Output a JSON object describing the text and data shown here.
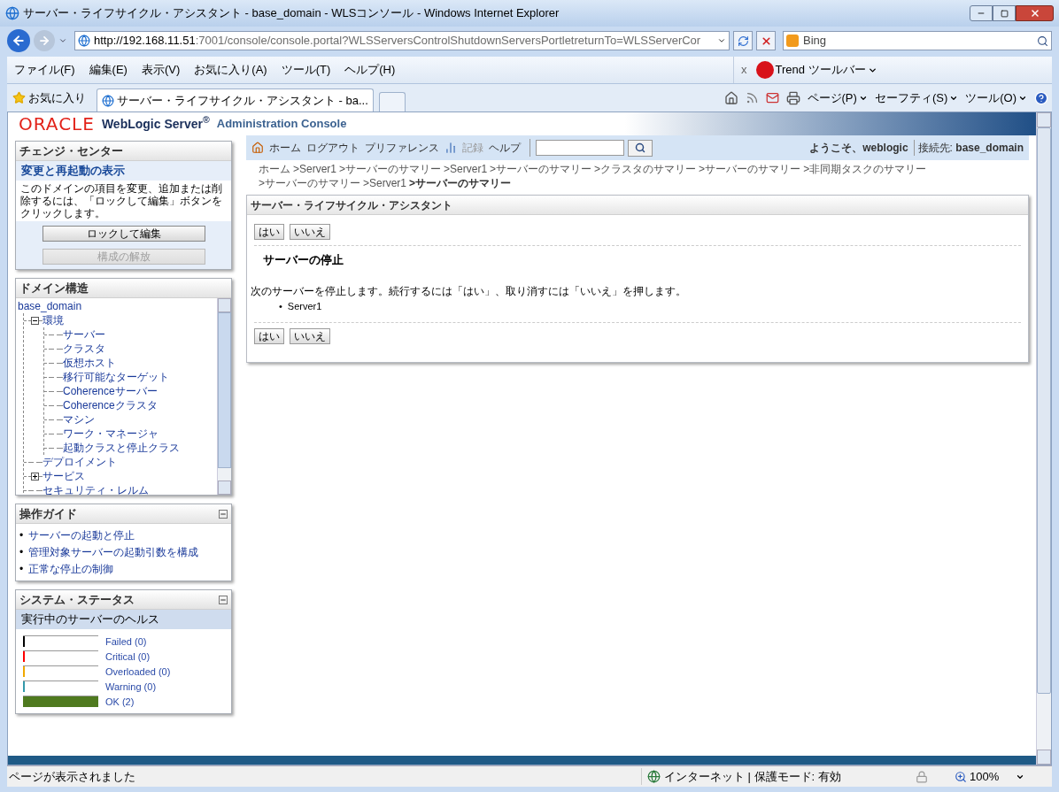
{
  "window": {
    "title": "サーバー・ライフサイクル・アシスタント - base_domain - WLSコンソール - Windows Internet Explorer"
  },
  "address_bar": {
    "url_host": "http://192.168.11.51",
    "url_rest": ":7001/console/console.portal?WLSServersControlShutdownServersPortletreturnTo=WLSServerCor"
  },
  "search_box": {
    "provider": "Bing"
  },
  "menu": [
    "ファイル(F)",
    "編集(E)",
    "表示(V)",
    "お気に入り(A)",
    "ツール(T)",
    "ヘルプ(H)"
  ],
  "toolbar_close": "x",
  "trend_toolbar": "Trend ツールバー",
  "favorites_bar": {
    "favorites": "お気に入り",
    "tab": "サーバー・ライフサイクル・アシスタント - ba...",
    "commands": [
      "ページ(P)",
      "セーフティ(S)",
      "ツール(O)"
    ]
  },
  "header": {
    "brand": "ORACLE",
    "product": "WebLogic Server",
    "mark": "®",
    "subtitle": "Administration Console"
  },
  "change_center": {
    "title": "チェンジ・センター",
    "link": "変更と再起動の表示",
    "text": "このドメインの項目を変更、追加または削除するには、「ロックして編集」ボタンをクリックします。",
    "buttons": [
      {
        "label": "ロックして編集",
        "disabled": false
      },
      {
        "label": "構成の解放",
        "disabled": true
      }
    ]
  },
  "domain_structure": {
    "title": "ドメイン構造",
    "root": "base_domain",
    "tree": [
      {
        "label": "環境",
        "expanded": true,
        "children": [
          {
            "label": "サーバー"
          },
          {
            "label": "クラスタ"
          },
          {
            "label": "仮想ホスト"
          },
          {
            "label": "移行可能なターゲット"
          },
          {
            "label": "Coherenceサーバー"
          },
          {
            "label": "Coherenceクラスタ"
          },
          {
            "label": "マシン"
          },
          {
            "label": "ワーク・マネージャ"
          },
          {
            "label": "起動クラスと停止クラス"
          }
        ]
      },
      {
        "label": "デプロイメント"
      },
      {
        "label": "サービス",
        "expanded": false
      },
      {
        "label": "セキュリティ・レルム"
      }
    ]
  },
  "how_do_i": {
    "title": "操作ガイド",
    "bullet": "•",
    "links": [
      "サーバーの起動と停止",
      "管理対象サーバーの起動引数を構成",
      "正常な停止の制御"
    ]
  },
  "system_status": {
    "title": "システム・ステータス",
    "subtitle": "実行中のサーバーのヘルス",
    "bars": [
      {
        "label": "Failed (0)",
        "color": "#000000",
        "level": 0
      },
      {
        "label": "Critical (0)",
        "color": "#ff0000",
        "level": 0
      },
      {
        "label": "Overloaded (0)",
        "color": "#f0a800",
        "level": 0
      },
      {
        "label": "Warning (0)",
        "color": "#3399aa",
        "level": 0
      },
      {
        "label": "OK (2)",
        "color": "#4f7a1f",
        "level": 1
      }
    ]
  },
  "nav": {
    "links": [
      "ホーム",
      "ログアウト",
      "プリファレンス"
    ],
    "record": "記録",
    "help": "ヘルプ",
    "welcome": "ようこそ、",
    "user": "weblogic",
    "connected": "接続先:",
    "domain": "base_domain"
  },
  "breadcrumbs": [
    {
      "label": "ホーム",
      "current": false
    },
    {
      "label": ">Server1",
      "current": false
    },
    {
      "label": ">サーバーのサマリー",
      "current": false
    },
    {
      "label": ">Server1",
      "current": false
    },
    {
      "label": ">サーバーのサマリー",
      "current": false
    },
    {
      "label": ">クラスタのサマリー",
      "current": false
    },
    {
      "label": ">サーバーのサマリー",
      "current": false
    },
    {
      "label": ">非同期タスクのサマリー",
      "current": false
    },
    {
      "label": ">サーバーのサマリー",
      "current": false
    },
    {
      "label": ">Server1",
      "current": false
    },
    {
      "label": ">サーバーのサマリー",
      "current": true
    }
  ],
  "assistant": {
    "title": "サーバー・ライフサイクル・アシスタント",
    "buttons_top": [
      "はい",
      "いいえ"
    ],
    "heading": "サーバーの停止",
    "message": "次のサーバーを停止します。続行するには「はい」、取り消すには「いいえ」を押します。",
    "bullet": "•",
    "servers": [
      "Server1"
    ],
    "buttons_bottom": [
      "はい",
      "いいえ"
    ]
  },
  "status_bar": {
    "text": "ページが表示されました",
    "zone": "インターネット | 保護モード: 有効",
    "zoom": "100%"
  }
}
